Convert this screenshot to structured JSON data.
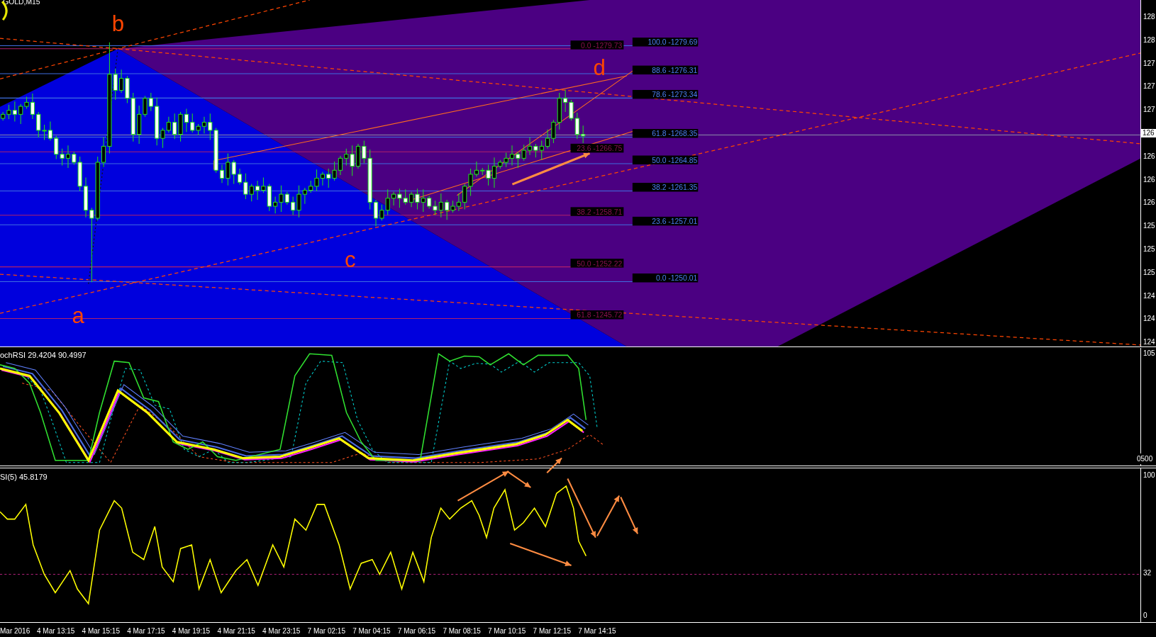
{
  "chart": {
    "symbol": "GOLD,M15",
    "wave_labels": [
      {
        "text": "b"
      },
      {
        "text": "a"
      },
      {
        "text": "c"
      },
      {
        "text": "d"
      }
    ],
    "fib_upper": [
      {
        "text": "100.0 -1279.69"
      },
      {
        "text": "88.6 -1276.31"
      },
      {
        "text": "78.6 -1273.34"
      },
      {
        "text": "61.8 -1268.35"
      },
      {
        "text": "50.0 -1264.85"
      },
      {
        "text": "38.2 -1261.35"
      },
      {
        "text": "23.6 -1257.01"
      },
      {
        "text": "0.0 -1250.01"
      }
    ],
    "fib_lower": [
      {
        "text": "0.0 -1279.73"
      },
      {
        "text": "23.6 -1266.75"
      },
      {
        "text": "38.2 -1258.71"
      },
      {
        "text": "50.0 -1252.22"
      },
      {
        "text": "61.8 -1245.72"
      }
    ]
  },
  "price_axis": [
    {
      "text": "128",
      "kind": "tick"
    },
    {
      "text": "128",
      "kind": "tick"
    },
    {
      "text": "127",
      "kind": "tick"
    },
    {
      "text": "127",
      "kind": "tick"
    },
    {
      "text": "127",
      "kind": "tick"
    },
    {
      "text": "126",
      "kind": "current"
    },
    {
      "text": "126",
      "kind": "tick"
    },
    {
      "text": "126",
      "kind": "tick"
    },
    {
      "text": "126",
      "kind": "tick"
    },
    {
      "text": "125",
      "kind": "tick"
    },
    {
      "text": "125",
      "kind": "tick"
    },
    {
      "text": "125",
      "kind": "tick"
    },
    {
      "text": "124",
      "kind": "tick"
    },
    {
      "text": "124",
      "kind": "tick"
    },
    {
      "text": "124",
      "kind": "tick"
    }
  ],
  "stoch_rsi": {
    "label": "ochRSI 29.4204 90.4997",
    "scale": [
      "105",
      "0500"
    ]
  },
  "rsi": {
    "label": "SI(5) 45.8179",
    "scale": [
      "100",
      "32",
      "0"
    ]
  },
  "time_axis": [
    "Mar 2016",
    "4 Mar 13:15",
    "4 Mar 15:15",
    "4 Mar 17:15",
    "4 Mar 19:15",
    "4 Mar 21:15",
    "4 Mar 23:15",
    "7 Mar 02:15",
    "7 Mar 04:15",
    "7 Mar 06:15",
    "7 Mar 08:15",
    "7 Mar 10:15",
    "7 Mar 12:15",
    "7 Mar 14:15"
  ]
}
